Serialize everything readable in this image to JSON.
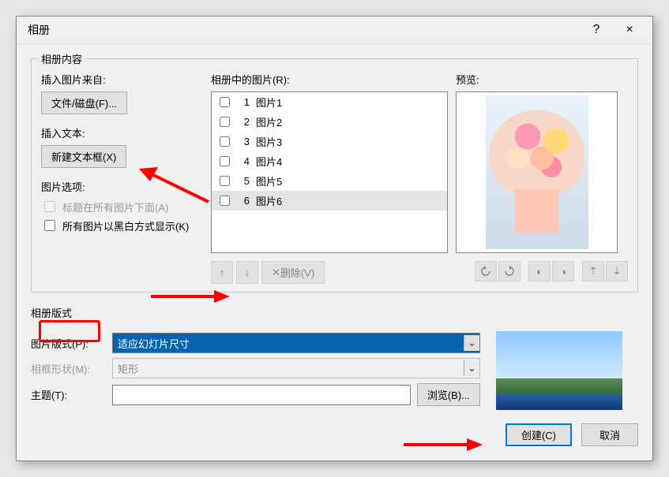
{
  "dialog": {
    "title": "相册",
    "help": "?",
    "close": "×"
  },
  "content_legend": "相册内容",
  "insert_from_label": "插入图片来自:",
  "file_disk_btn": "文件/磁盘(F)...",
  "insert_text_label": "插入文本:",
  "new_textbox_btn": "新建文本框(X)",
  "picture_options_label": "图片选项:",
  "caption_below_label": "标题在所有图片下面(A)",
  "all_bw_label": "所有图片以黑白方式显示(K)",
  "pictures_in_album_label": "相册中的图片(R):",
  "preview_label": "预览:",
  "pictures": [
    {
      "idx": "1",
      "name": "图片1",
      "selected": false
    },
    {
      "idx": "2",
      "name": "图片2",
      "selected": false
    },
    {
      "idx": "3",
      "name": "图片3",
      "selected": false
    },
    {
      "idx": "4",
      "name": "图片4",
      "selected": false
    },
    {
      "idx": "5",
      "name": "图片5",
      "selected": false
    },
    {
      "idx": "6",
      "name": "图片6",
      "selected": true
    }
  ],
  "move_up": "↑",
  "move_down": "↓",
  "delete_btn": "删除(V)",
  "layout_legend": "相册版式",
  "picture_layout_label": "图片版式(P):",
  "picture_layout_value": "适应幻灯片尺寸",
  "frame_shape_label": "相框形状(M):",
  "frame_shape_value": "矩形",
  "theme_label": "主题(T):",
  "theme_value": "",
  "browse_btn": "浏览(B)...",
  "create_btn": "创建(C)",
  "cancel_btn": "取消",
  "select_arrow": "⌄"
}
